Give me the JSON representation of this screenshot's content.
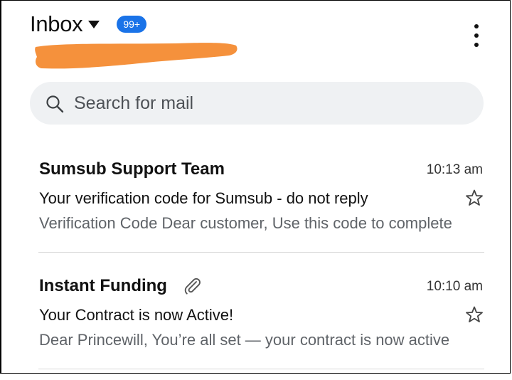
{
  "header": {
    "title": "Inbox",
    "unread_badge": "99+"
  },
  "search": {
    "placeholder": "Search for mail"
  },
  "colors": {
    "badge": "#1a73e8",
    "redaction": "#f5913c",
    "search_bg": "#eff1f3"
  },
  "emails": [
    {
      "sender": "Sumsub Support Team",
      "time": "10:13 am",
      "subject": "Your verification code for Sumsub - do not reply",
      "snippet": "Verification Code Dear customer, Use this code to complete",
      "has_attachment": false,
      "starred": false
    },
    {
      "sender": "Instant Funding",
      "time": "10:10 am",
      "subject": "Your Contract is now Active!",
      "snippet": "Dear Princewill, You’re all set — your contract is now active",
      "has_attachment": true,
      "starred": false
    }
  ]
}
